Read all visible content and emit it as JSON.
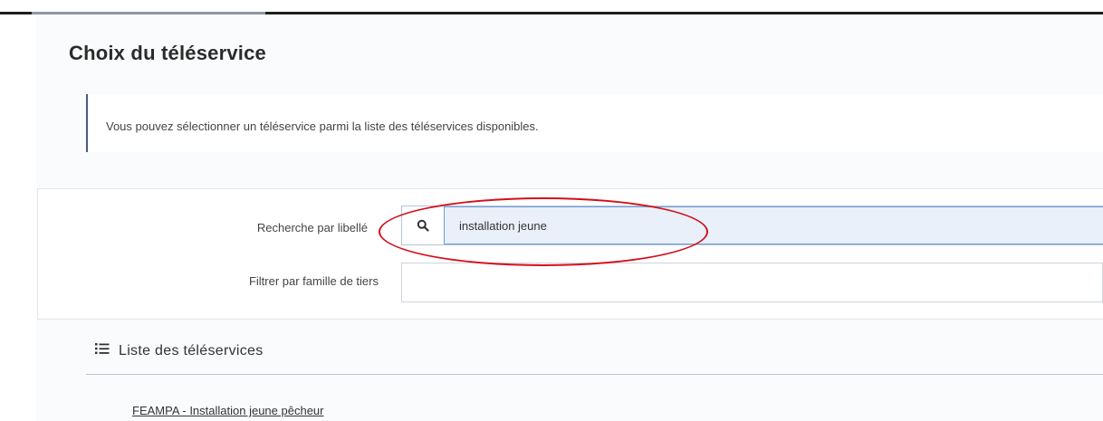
{
  "page": {
    "title": "Choix du téléservice",
    "info_text": "Vous pouvez sélectionner un téléservice parmi la liste des téléservices disponibles."
  },
  "search": {
    "label": "Recherche par libellé",
    "value": "installation jeune",
    "icon": "search-icon"
  },
  "filter": {
    "label": "Filtrer par famille de tiers",
    "value": ""
  },
  "list": {
    "title": "Liste des téléservices",
    "icon": "list-icon",
    "items": [
      {
        "label": "FEAMPA - Installation jeune pêcheur"
      }
    ]
  },
  "colors": {
    "accent_border": "#4a5a7a",
    "input_focus_bg": "#e9f0f9",
    "highlight_oval": "#d40f1a"
  }
}
